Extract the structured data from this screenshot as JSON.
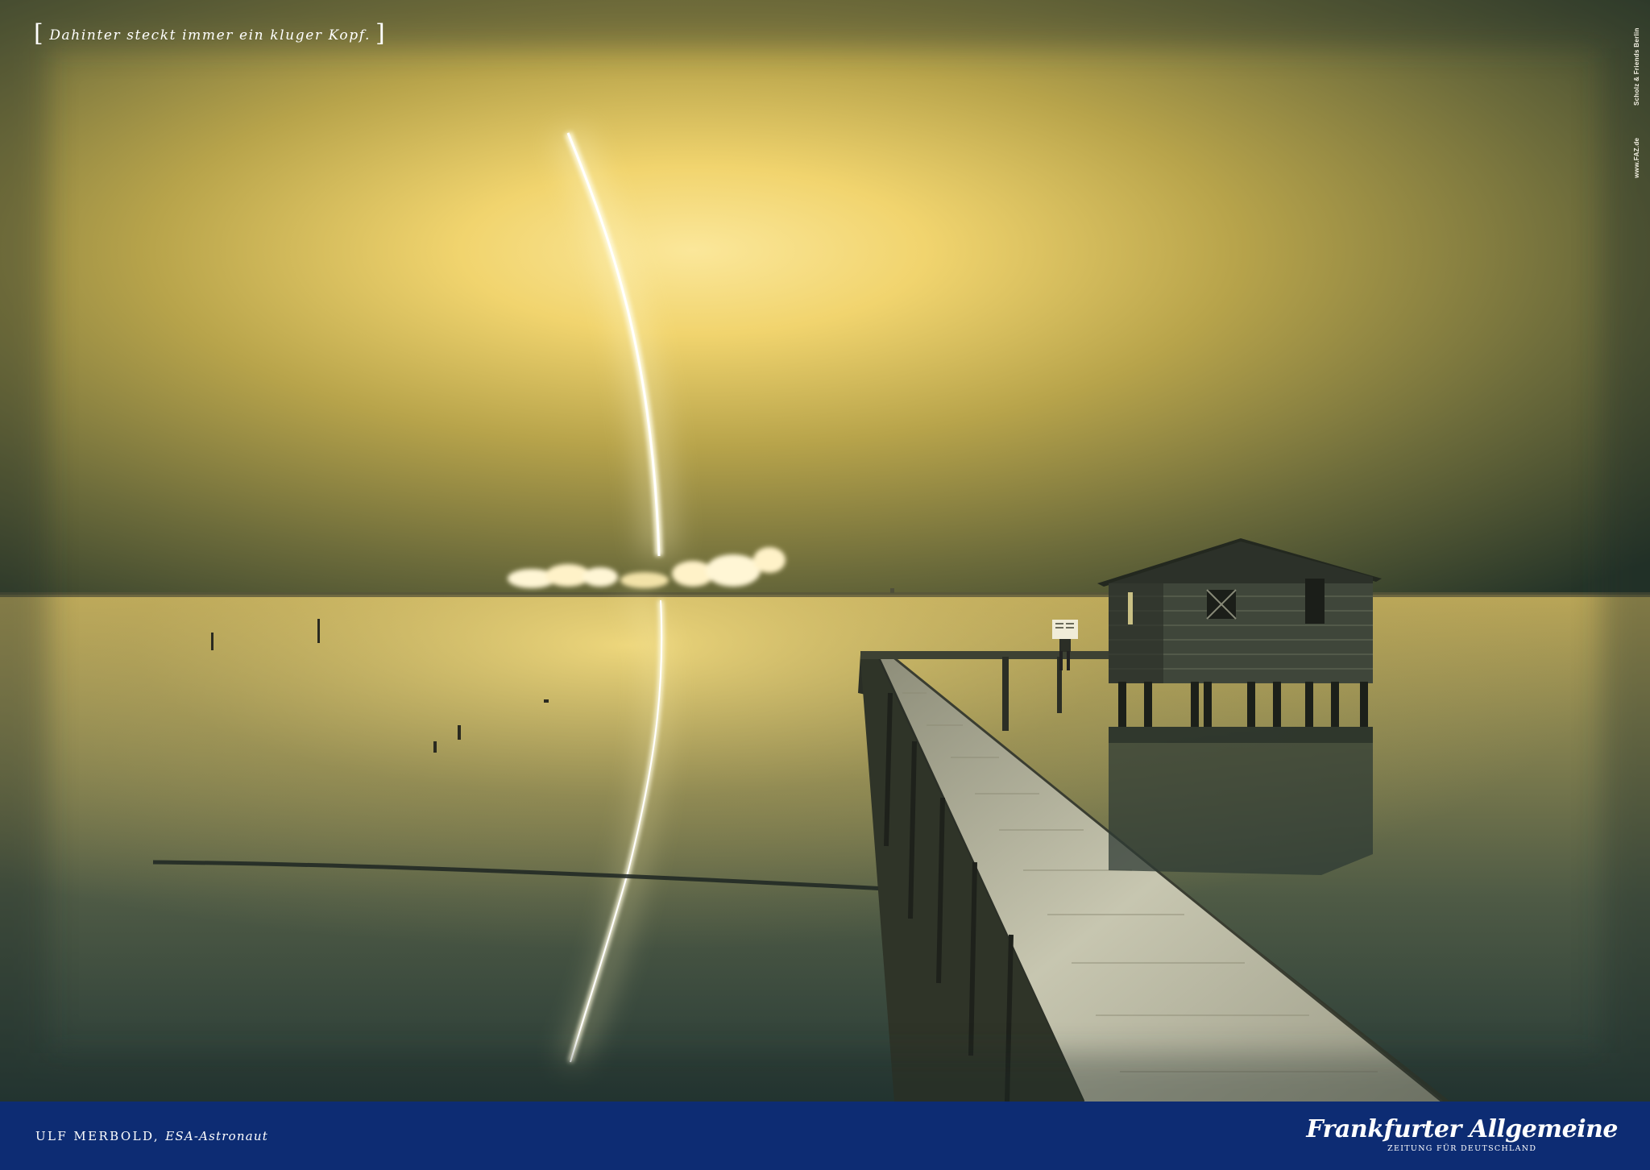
{
  "poster": {
    "tagline": "Dahinter steckt immer ein kluger Kopf.",
    "tagline_bracket_open": "[",
    "tagline_bracket_close": "]",
    "side_credits": {
      "agency": "Scholz & Friends Berlin",
      "website": "www.FAZ.de"
    },
    "footer": {
      "person_name": "ULF MERBOLD,",
      "person_role": "ESA-Astronaut",
      "logo_masthead": "Frankfurter Allgemeine",
      "logo_subtitle": "ZEITUNG FÜR DEUTSCHLAND"
    }
  },
  "colors": {
    "footer_band": "#0d2c73",
    "sky_glow": "#f6dc74",
    "sky_edge": "#2d3a2c",
    "water": "#5e6446"
  },
  "scene_elements": [
    "rocket-trail-glow",
    "launch-smoke-cloud",
    "wooden-pier",
    "stilt-house",
    "person-reading-newspaper",
    "water-reflection"
  ]
}
